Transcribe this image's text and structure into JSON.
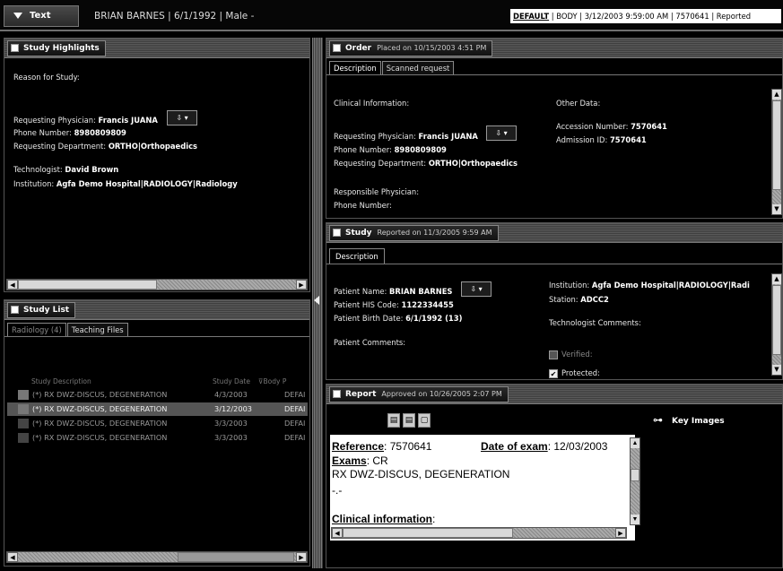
{
  "topbar": {
    "text_button": "Text",
    "patient_info": "BRIAN BARNES  | 6/1/1992  | Male -",
    "right_default": "DEFAULT",
    "right_info": " | BODY | 3/12/2003 9:59:00 AM | 7570641 | Reported"
  },
  "study_highlights": {
    "title": "Study Highlights",
    "reason_label": "Reason for Study:",
    "requesting_physician_label": "Requesting Physician:",
    "requesting_physician": "Francis JUANA",
    "phone_label": "Phone Number:",
    "phone": "8980809809",
    "dept_label": "Requesting Department:",
    "dept": "ORTHO|Orthopaedics",
    "tech_label": "Technologist:",
    "tech": "David Brown",
    "inst_label": "Institution:",
    "inst": "Agfa Demo Hospital|RADIOLOGY|Radiology"
  },
  "study_list": {
    "title": "Study List",
    "tabs": [
      "Radiology (4)",
      "Teaching Files"
    ],
    "columns": [
      "Study Description",
      "Study Date",
      "Body P"
    ],
    "rows": [
      {
        "desc": "(*) RX DWZ-DISCUS, DEGENERATION",
        "date": "4/3/2003",
        "body": "DEFAI"
      },
      {
        "desc": "(*) RX DWZ-DISCUS, DEGENERATION",
        "date": "3/12/2003",
        "body": "DEFAI"
      },
      {
        "desc": "(*) RX DWZ-DISCUS, DEGENERATION",
        "date": "3/3/2003",
        "body": "DEFAI"
      },
      {
        "desc": "(*) RX DWZ-DISCUS, DEGENERATION",
        "date": "3/3/2003",
        "body": "DEFAI"
      }
    ]
  },
  "order": {
    "title": "Order",
    "subtitle": "Placed on 10/15/2003 4:51 PM",
    "tabs": [
      "Description",
      "Scanned request"
    ],
    "clinical_label": "Clinical Information:",
    "other_label": "Other Data:",
    "req_phys_label": "Requesting Physician:",
    "req_phys": "Francis JUANA",
    "phone_label": "Phone Number:",
    "phone": "8980809809",
    "dept_label": "Requesting Department:",
    "dept": "ORTHO|Orthopaedics",
    "accession_label": "Accession Number:",
    "accession": "7570641",
    "admission_label": "Admission ID:",
    "admission": "7570641",
    "resp_phys_label": "Responsible Physician:",
    "resp_phone_label": "Phone Number:"
  },
  "study": {
    "title": "Study",
    "subtitle": "Reported on 11/3/2005 9:59 AM",
    "tab": "Description",
    "patient_name_label": "Patient Name:",
    "patient_name": "BRIAN BARNES",
    "his_label": "Patient HIS Code:",
    "his": "1122334455",
    "birth_label": "Patient Birth Date:",
    "birth": "6/1/1992 (13)",
    "comments_label": "Patient Comments:",
    "inst_label": "Institution:",
    "inst": "Agfa Demo Hospital|RADIOLOGY|Radi",
    "station_label": "Station:",
    "station": "ADCC2",
    "tech_comments_label": "Technologist Comments:",
    "verified_label": "Verified:",
    "protected_label": "Protected:"
  },
  "report": {
    "title": "Report",
    "subtitle": "Approved on  10/26/2005 2:07 PM",
    "key_images": "Key Images",
    "reference_label": "Reference",
    "reference": ": 7570641",
    "date_label": "Date of exam",
    "date": ": 12/03/2003",
    "exams_label": "Exams",
    "exams": ": CR",
    "exam_desc": "RX DWZ-DISCUS, DEGENERATION",
    "dash": "-.-",
    "clinical_label": "Clinical information",
    "clinical_colon": ":"
  }
}
